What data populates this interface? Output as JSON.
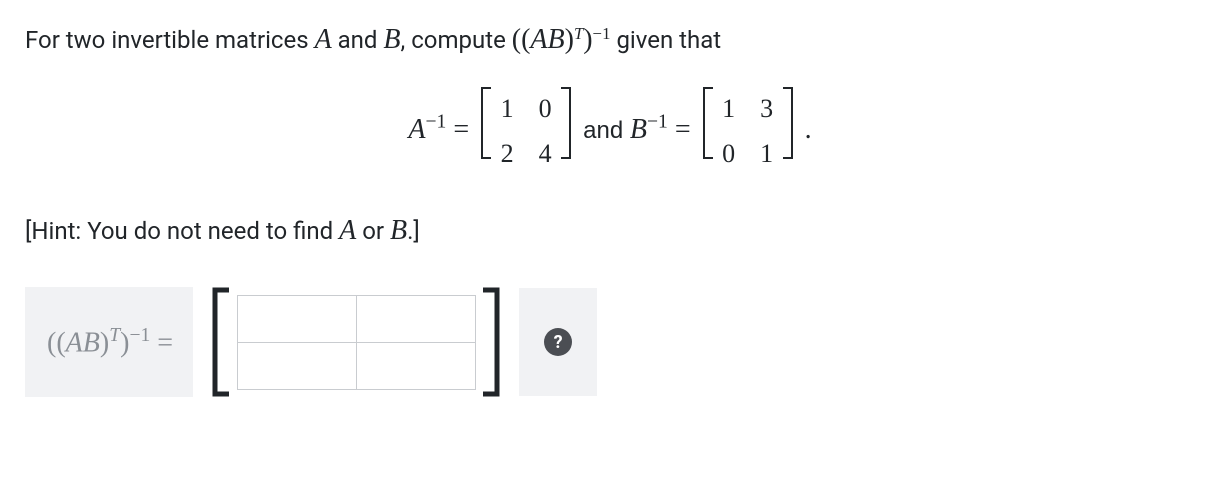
{
  "problem": {
    "prefix": "For two invertible matrices ",
    "A": "A",
    "and1": " and ",
    "B": "B",
    "mid": ", compute ",
    "expr_open": "((",
    "expr_AB": "AB",
    "expr_close_paren": ")",
    "expr_T": "T",
    "expr_close2": ")",
    "expr_neg1": "−1",
    "suffix": " given that"
  },
  "equation": {
    "A_label": "A",
    "A_sup": "−1",
    "eq1": " = ",
    "A_inv_matrix": [
      [
        "1",
        "0"
      ],
      [
        "2",
        "4"
      ]
    ],
    "and_text": " and ",
    "B_label": "B",
    "B_sup": "−1",
    "eq2": " = ",
    "B_inv_matrix": [
      [
        "1",
        "3"
      ],
      [
        "0",
        "1"
      ]
    ],
    "period": "."
  },
  "hint": {
    "open": "[Hint: You do not need to find ",
    "A": "A",
    "or": " or ",
    "B": "B",
    "close": ".]"
  },
  "answer": {
    "label_open": "((",
    "label_AB": "AB",
    "label_cp": ")",
    "label_T": "T",
    "label_cp2": ")",
    "label_neg1": "−1",
    "label_eq": " = ",
    "inputs": {
      "r0c0": "",
      "r0c1": "",
      "r1c0": "",
      "r1c1": ""
    },
    "help_glyph": "?"
  }
}
